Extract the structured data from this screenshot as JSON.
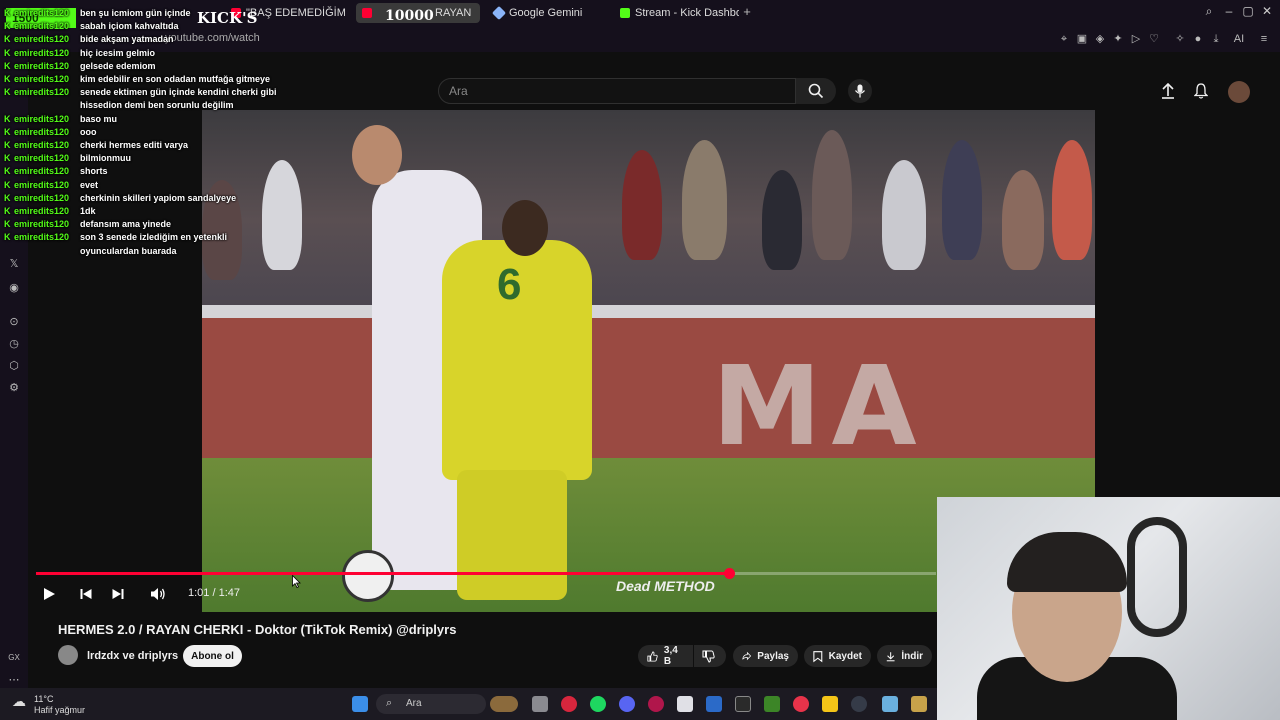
{
  "browser": {
    "tabs": [
      {
        "label": "\"BAŞ EDEMEDİĞİM",
        "favicon_color": "#ff0033",
        "active": false
      },
      {
        "label": "RAYAN",
        "favicon_color": "#ff0033",
        "active": true
      },
      {
        "label": "Google Gemini",
        "favicon_color": "#8ab4f8",
        "active": false
      },
      {
        "label": "Stream - Kick Dashboard",
        "favicon_color": "#53fc18",
        "active": false
      }
    ],
    "url": "youtube.com/watch"
  },
  "overlay": {
    "follower_count": "1500",
    "title": "KICK'S",
    "goal_counter": "10000"
  },
  "chat": {
    "messages": [
      {
        "user": "emiredits120",
        "text": "ben şu icmiom gün içinde"
      },
      {
        "user": "emiredits120",
        "text": "sabah içiom kahvaltıda"
      },
      {
        "user": "emiredits120",
        "text": "bide akşam yatmadan"
      },
      {
        "user": "emiredits120",
        "text": "hiç icesim gelmio"
      },
      {
        "user": "emiredits120",
        "text": "gelsede edemiom"
      },
      {
        "user": "emiredits120",
        "text": "kim edebilir en son odadan mutfağa gitmeye"
      },
      {
        "user": "emiredits120",
        "text": "senede ektimen gün içinde kendini cherki gibi hissedion demi ben sorunlu değilim"
      },
      {
        "user": "emiredits120",
        "text": "baso mu"
      },
      {
        "user": "emiredits120",
        "text": "ooo"
      },
      {
        "user": "emiredits120",
        "text": "cherki hermes editi varya"
      },
      {
        "user": "emiredits120",
        "text": "bilmionmuu"
      },
      {
        "user": "emiredits120",
        "text": "shorts"
      },
      {
        "user": "emiredits120",
        "text": "evet"
      },
      {
        "user": "emiredits120",
        "text": "cherkinin skilleri yapiom sandalyeye"
      },
      {
        "user": "emiredits120",
        "text": "1dk"
      },
      {
        "user": "emiredits120",
        "text": "defansım ama yinede"
      },
      {
        "user": "emiredits120",
        "text": "son 3 senede izlediğim en yetenkli oyunculardan buarada"
      }
    ]
  },
  "youtube": {
    "search_placeholder": "Ara",
    "video": {
      "board_text": "MA",
      "jersey_number": "6",
      "watermark": "Dead METHOD",
      "time_current": "1:01",
      "time_total": "1:47",
      "timecode": "1:01 / 1:47",
      "progress_fraction": 0.77
    },
    "title": "HERMES 2.0 / RAYAN CHERKI - Doktor (TikTok Remix) @driplyrs",
    "channel": "lrdzdx ve driplyrs",
    "subscribe_label": "Abone ol",
    "likes": "3,4 B",
    "share_label": "Paylaş",
    "save_label": "Kaydet",
    "download_label": "İndir"
  },
  "taskbar": {
    "temperature": "11°C",
    "weather": "Hafif yağmur",
    "search_label": "Ara"
  },
  "colors": {
    "accent_red": "#ff0033",
    "kick_green": "#53fc18",
    "background": "#0f0f0f"
  }
}
